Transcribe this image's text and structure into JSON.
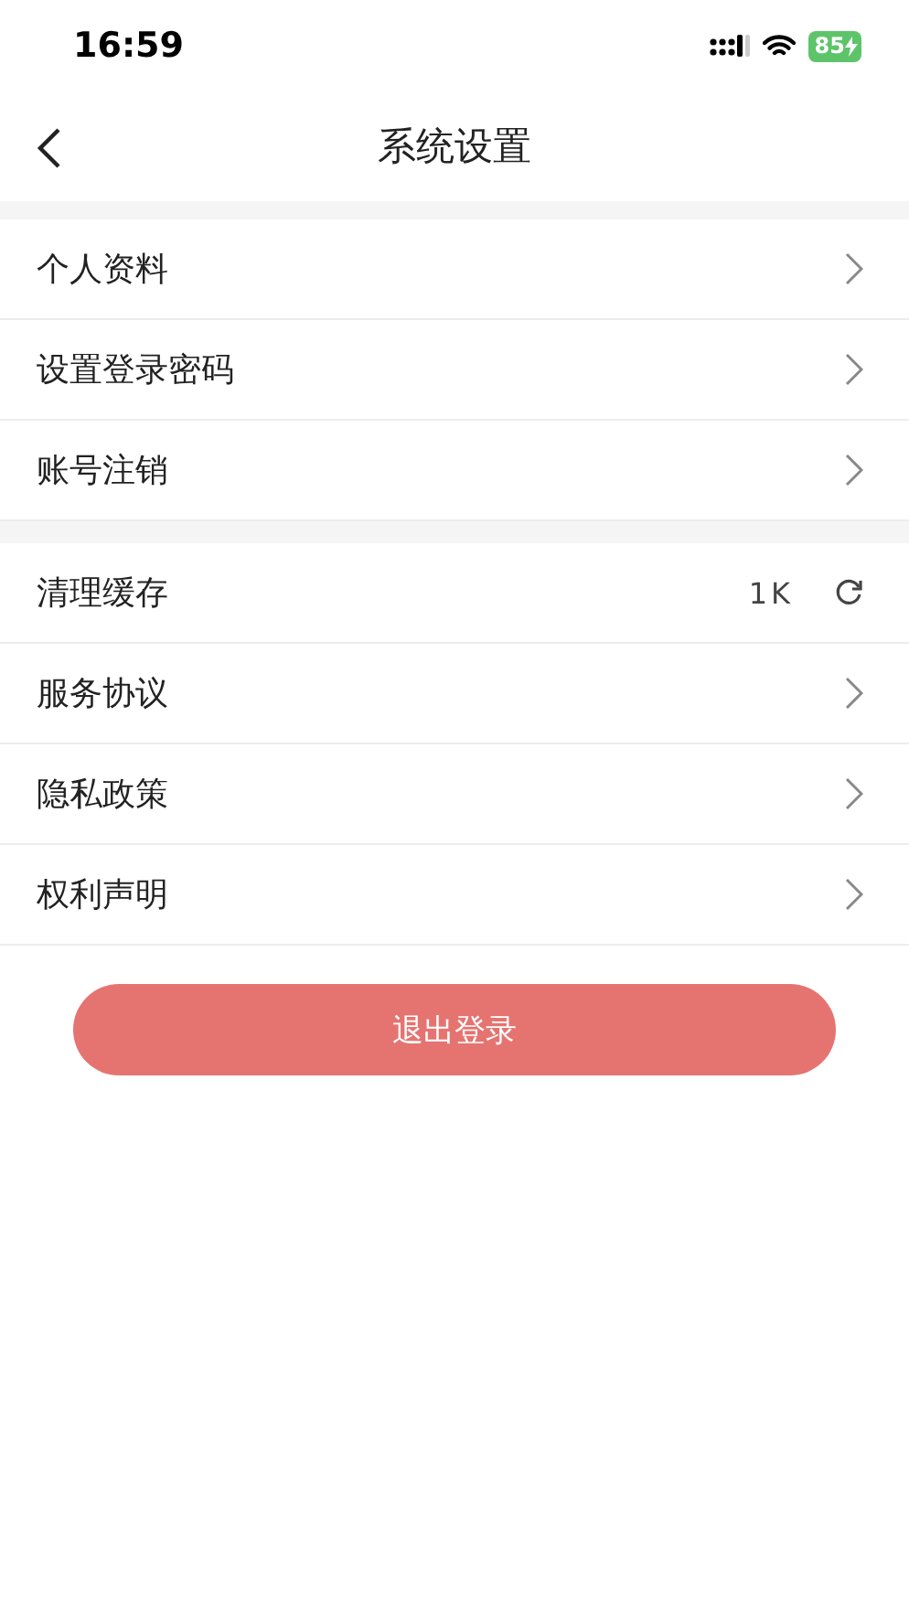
{
  "status_bar": {
    "time": "16:59",
    "battery": "85"
  },
  "nav_bar": {
    "title": "系统设置"
  },
  "groups": [
    {
      "rows": [
        {
          "kind": "link",
          "label": "个人资料"
        },
        {
          "kind": "link",
          "label": "设置登录密码"
        },
        {
          "kind": "link",
          "label": "账号注销"
        }
      ]
    },
    {
      "rows": [
        {
          "kind": "value",
          "label": "清理缓存",
          "value": "1K"
        },
        {
          "kind": "link",
          "label": "服务协议"
        },
        {
          "kind": "link",
          "label": "隐私政策"
        },
        {
          "kind": "link",
          "label": "权利声明"
        }
      ]
    }
  ],
  "logout_button": {
    "label": "退出登录"
  }
}
